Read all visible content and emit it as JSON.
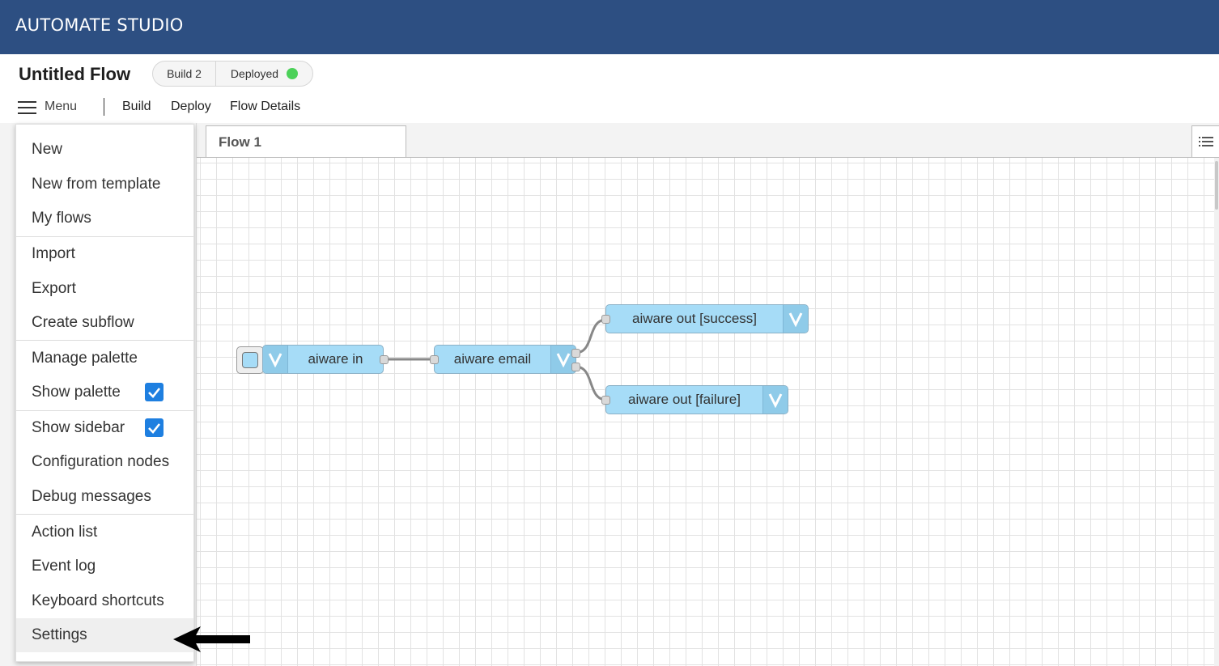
{
  "app": {
    "brand": "AUTOMATE STUDIO"
  },
  "header": {
    "flow_title": "Untitled Flow",
    "build_label": "Build 2",
    "deploy_status": "Deployed",
    "deploy_status_color": "#4cd159",
    "menu_label": "Menu",
    "nav": {
      "build": "Build",
      "deploy": "Deploy",
      "flow_details": "Flow Details"
    }
  },
  "workspace": {
    "tab_label": "Flow 1",
    "nodes": {
      "in": "aiware in",
      "email": "aiware email",
      "success": "aiware out [success]",
      "failure": "aiware out [failure]"
    },
    "node_color": "#a6dcf7"
  },
  "menu": {
    "new": "New",
    "new_from_template": "New from template",
    "my_flows": "My flows",
    "import": "Import",
    "export": "Export",
    "create_subflow": "Create subflow",
    "manage_palette": "Manage palette",
    "show_palette": "Show palette",
    "show_palette_checked": true,
    "show_sidebar": "Show sidebar",
    "show_sidebar_checked": true,
    "configuration_nodes": "Configuration nodes",
    "debug_messages": "Debug messages",
    "action_list": "Action list",
    "event_log": "Event log",
    "keyboard_shortcuts": "Keyboard shortcuts",
    "settings": "Settings",
    "highlighted_item": "Settings",
    "checkbox_color": "#1e7fe0"
  },
  "icons": {
    "hamburger": "hamburger-icon",
    "tab_list": "list-icon",
    "node": "aiware-v-icon",
    "checkbox": "checkmark-icon",
    "pointer": "arrow-left-icon"
  }
}
